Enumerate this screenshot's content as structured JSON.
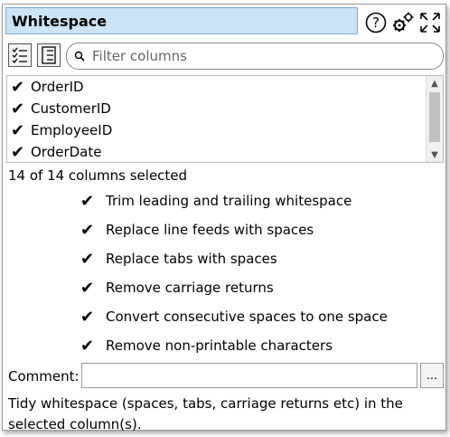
{
  "window": {
    "title": "Whitespace"
  },
  "toolbar": {
    "help_icon": "help-icon",
    "settings_icon": "gear-icon",
    "expand_icon": "expand-icon"
  },
  "filter": {
    "placeholder": "Filter columns"
  },
  "columns": [
    {
      "name": "OrderID",
      "checked": true
    },
    {
      "name": "CustomerID",
      "checked": true
    },
    {
      "name": "EmployeeID",
      "checked": true
    },
    {
      "name": "OrderDate",
      "checked": true
    }
  ],
  "status": "14 of 14 columns selected",
  "options": [
    {
      "label": "Trim leading and trailing whitespace",
      "checked": true
    },
    {
      "label": "Replace line feeds with spaces",
      "checked": true
    },
    {
      "label": "Replace tabs with spaces",
      "checked": true
    },
    {
      "label": "Remove carriage returns",
      "checked": true
    },
    {
      "label": "Convert consecutive spaces to one space",
      "checked": true
    },
    {
      "label": "Remove non-printable characters",
      "checked": true
    }
  ],
  "comment": {
    "label": "Comment:",
    "value": "",
    "button_label": "..."
  },
  "description": "Tidy whitespace (spaces, tabs, carriage returns etc) in the selected column(s).",
  "colors": {
    "title_bg": "#cce4f7",
    "title_border": "#7aa7d6"
  }
}
